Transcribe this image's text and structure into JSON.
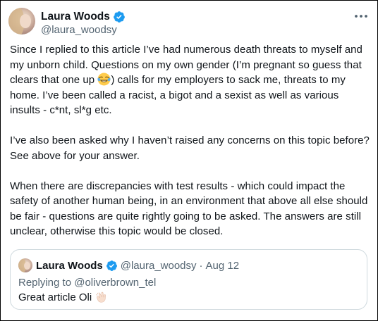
{
  "tweet": {
    "author_name": "Laura Woods",
    "author_handle": "@laura_woodsy",
    "paragraphs": {
      "p1_before_emoji": "Since I replied to this article I’ve had numerous death threats to myself and my unborn child. Questions on my own gender (I’m pregnant so guess that clears that one up ",
      "p1_after_emoji": ") calls for my employers to sack me, threats to my home. I’ve been called a racist, a bigot and a sexist as well as various insults - c*nt, sl*g etc.",
      "p2": "I’ve also been asked why I haven’t raised any concerns on this topic before? See above for your answer.",
      "p3": "When there are discrepancies with test results - which could impact the safety of another human being, in an environment that above all else should be fair - questions are quite rightly going to be asked. The answers are still unclear, otherwise this topic would be closed."
    },
    "icons": {
      "verified": "verified-badge-icon",
      "more": "more-options-icon",
      "emoji1": "face-with-tears-of-joy-emoji",
      "emoji2": "clapping-hands-emoji"
    },
    "colors": {
      "verified_blue": "#1d9bf0",
      "secondary_text": "#536471",
      "primary_text": "#0f1419"
    }
  },
  "quoted_tweet": {
    "author_name": "Laura Woods",
    "author_handle": "@laura_woodsy",
    "separator": "·",
    "date": "Aug 12",
    "reply_line": "Replying to @oliverbrown_tel",
    "text": "Great article Oli"
  }
}
